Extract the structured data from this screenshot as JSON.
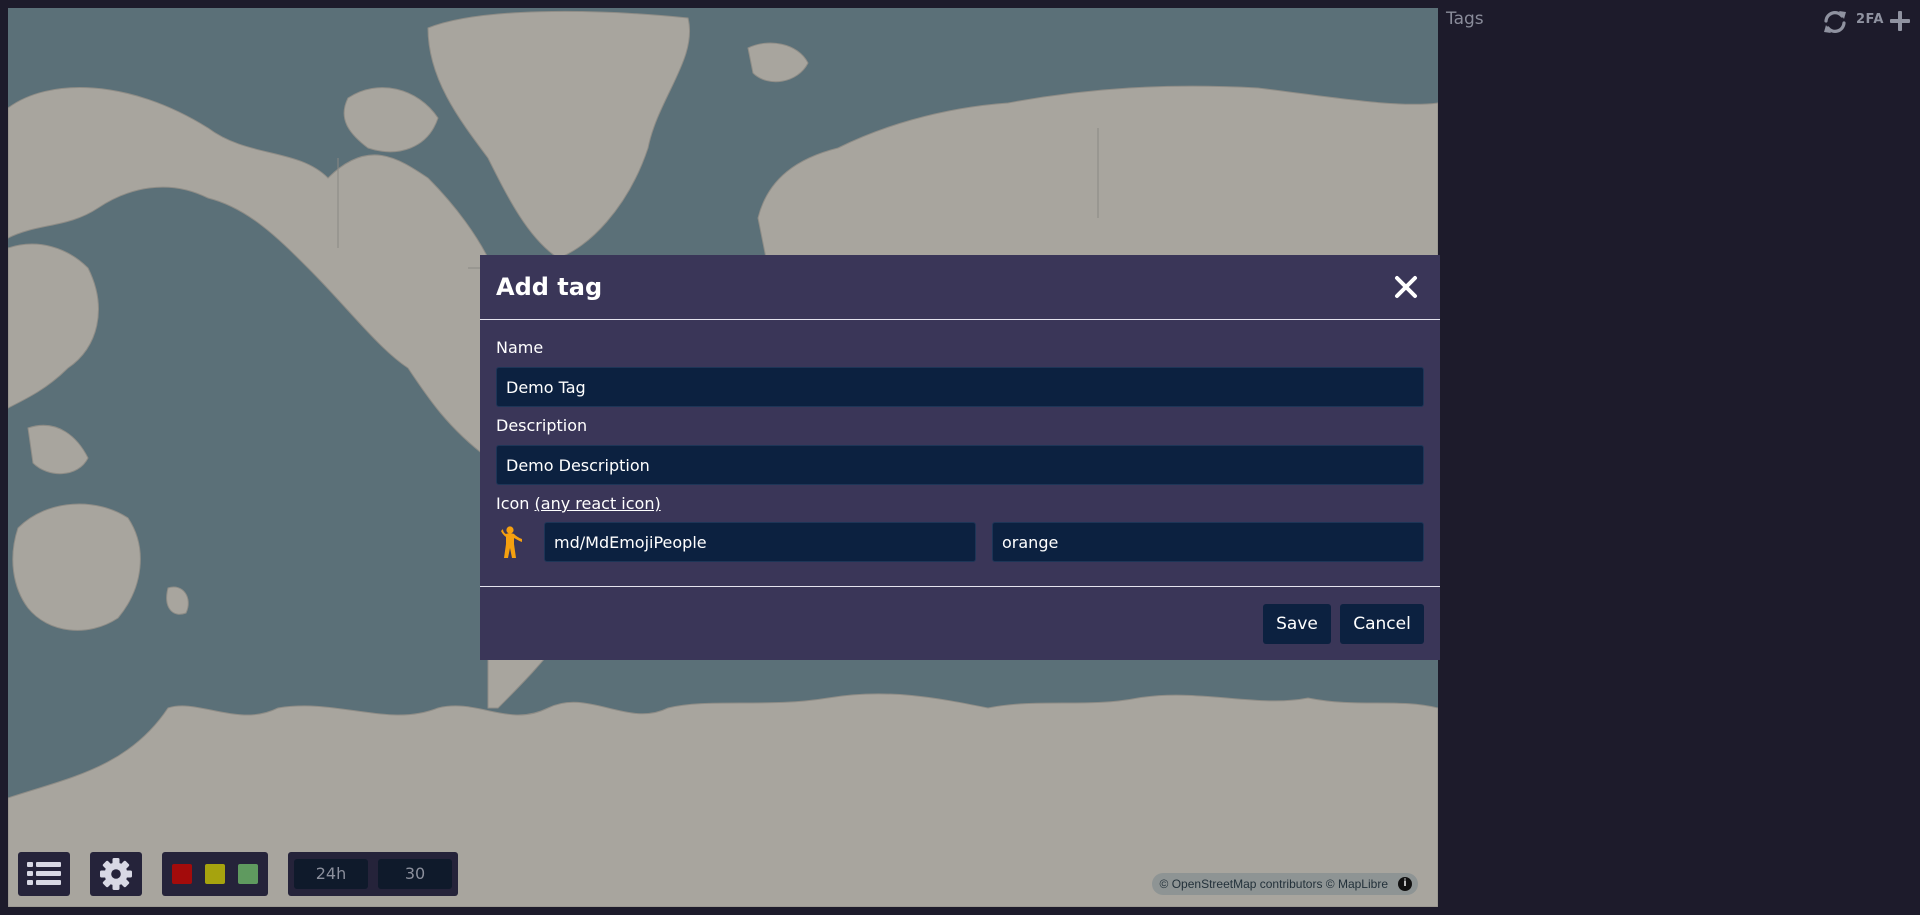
{
  "map": {
    "attribution": "© OpenStreetMap contributors © MapLibre",
    "attribution_info": "i"
  },
  "toolbar": {
    "list_icon": "list-icon",
    "gear_icon": "gear-icon",
    "status_colors": [
      "#a30b0b",
      "#a6a30e",
      "#5f9a5f"
    ],
    "time_range_label": "24h",
    "count_label": "30"
  },
  "sidebar": {
    "title": "Tags",
    "refresh_icon": "refresh-icon",
    "twofa_label": "2FA",
    "add_icon": "plus-icon"
  },
  "dialog": {
    "title": "Add tag",
    "name_label": "Name",
    "name_value": "Demo Tag",
    "description_label": "Description",
    "description_value": "Demo Description",
    "icon_label": "Icon ",
    "icon_link": "(any react icon)",
    "icon_value": "md/MdEmojiPeople",
    "color_value": "orange",
    "preview_icon": "emoji-people-icon",
    "preview_color": "#f5a00f",
    "save_label": "Save",
    "cancel_label": "Cancel"
  }
}
